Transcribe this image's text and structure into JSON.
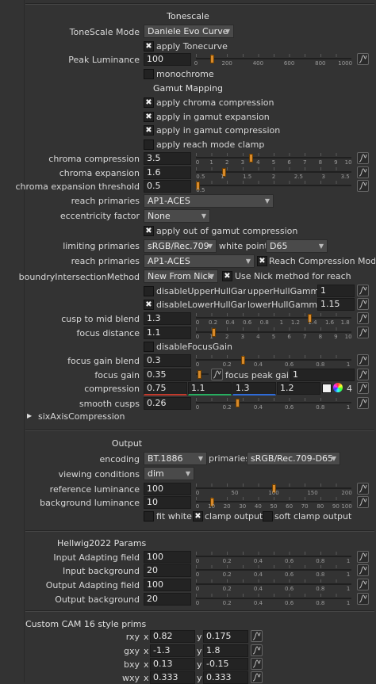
{
  "tonescale": {
    "header": "Tonescale",
    "mode_label": "ToneScale Mode",
    "mode_value": "Daniele Evo Curve",
    "apply_tonecurve": "apply Tonecurve",
    "peak_label": "Peak Luminance",
    "peak_value": "100",
    "peak_ticks": [
      "0",
      "200",
      "400",
      "600",
      "800",
      "1000"
    ],
    "monochrome": "monochrome"
  },
  "gamut": {
    "header": "Gamut Mapping",
    "apply_chroma": "apply chroma compression",
    "apply_expansion": "apply in gamut expansion",
    "apply_compression": "apply in gamut compression",
    "apply_reach": "apply reach mode clamp",
    "chroma_comp_label": "chroma compression",
    "chroma_comp_value": "3.5",
    "chroma_comp_ticks": [
      "0",
      "1",
      "2",
      "3",
      "4",
      "5",
      "6",
      "7",
      "8",
      "9",
      "10"
    ],
    "chroma_exp_label": "chroma expansion",
    "chroma_exp_value": "1.6",
    "chroma_exp_ticks": [
      "0.5",
      "1",
      "1.5",
      "2",
      "2.5",
      "3",
      "3.5"
    ],
    "chroma_thr_label": "chroma expansion threshold",
    "chroma_thr_value": "0.5",
    "chroma_thr_ticks": [
      "0.5"
    ],
    "reach_label": "reach primaries",
    "reach_value": "AP1-ACES",
    "ecc_label": "eccentricity factor",
    "ecc_value": "None",
    "apply_out": "apply out of gamut compression",
    "lim_label": "limiting primaries",
    "lim_value": "sRGB/Rec.709",
    "white_label": "white point",
    "white_value": "D65",
    "reach2_label": "reach primaries",
    "reach2_value": "AP1-ACES",
    "reach_comp": "Reach Compression Mode",
    "boundry_label": "boundryIntersectionMethod",
    "boundry_value": "New From Nick",
    "use_nick": "Use Nick method for reach",
    "dis_upper": "disableUpperHullGamma",
    "upper_label": "upperHullGamma",
    "upper_value": "1",
    "dis_lower": "disableLowerHullGamma",
    "lower_label": "lowerHullGamma",
    "lower_value": "1.15",
    "cusp_label": "cusp to mid blend",
    "cusp_value": "1.3",
    "cusp_ticks": [
      "0",
      "0.2",
      "0.4",
      "0.6",
      "0.8",
      "1",
      "1.2",
      "1.4",
      "1.6",
      "1.8"
    ],
    "focus_label": "focus distance",
    "focus_value": "1.1",
    "focus_ticks": [
      "0",
      "1",
      "2",
      "3",
      "4",
      "5",
      "6",
      "7",
      "8",
      "9",
      "10"
    ],
    "dis_focus": "disableFocusGain",
    "fgb_label": "focus gain blend",
    "fgb_value": "0.3",
    "fgb_ticks": [
      "0",
      "0.2",
      "0.4",
      "0.6",
      "0.8",
      "1"
    ],
    "fg_label": "focus gain",
    "fg_value": "0.35",
    "fpg_label": "focus peak gain",
    "fpg_value": "1",
    "comp_label": "compression",
    "comp_values": [
      "0.75",
      "1.1",
      "1.3",
      "1.2"
    ],
    "comp_count": "4",
    "smooth_label": "smooth cusps",
    "smooth_value": "0.26",
    "smooth_ticks": [
      "0",
      "0.2",
      "0.4",
      "0.6",
      "0.8",
      "1"
    ],
    "six_axis": "sixAxisCompression"
  },
  "output": {
    "header": "Output",
    "enc_label": "encoding",
    "enc_value": "BT.1886",
    "prim_label": "primaries",
    "prim_value": "sRGB/Rec.709-D65",
    "view_label": "viewing conditions",
    "view_value": "dim",
    "ref_label": "reference luminance",
    "ref_value": "100",
    "ref_ticks": [
      "0",
      "50",
      "100",
      "150",
      "200"
    ],
    "bg_label": "background luminance",
    "bg_value": "10",
    "bg_ticks": [
      "0",
      "10",
      "20",
      "30",
      "40",
      "50",
      "60",
      "70",
      "80",
      "90",
      "100"
    ],
    "fit_white": "fit white",
    "clamp": "clamp output",
    "soft_clamp": "soft clamp output"
  },
  "hellwig": {
    "header": "Hellwig2022 Params",
    "iaf_label": "Input Adapting field",
    "iaf_value": "100",
    "ib_label": "Input background",
    "ib_value": "20",
    "oaf_label": "Output Adapting field",
    "oaf_value": "100",
    "ob_label": "Output background",
    "ob_value": "20",
    "ticks": [
      "0",
      "0.2",
      "0.4",
      "0.6",
      "0.8",
      "1"
    ]
  },
  "cam": {
    "header": "Custom CAM 16 style prims",
    "rows": [
      {
        "label": "rxy",
        "x": "0.82",
        "y": "0.175"
      },
      {
        "label": "gxy",
        "x": "-1.3",
        "y": "1.8"
      },
      {
        "label": "bxy",
        "x": "0.13",
        "y": "-0.15"
      },
      {
        "label": "wxy",
        "x": "0.333",
        "y": "0.333"
      }
    ],
    "x_prefix": "x",
    "y_prefix": "y"
  },
  "colors": {
    "handle": "#d88a2a",
    "bg": "#333333",
    "field": "#232323",
    "comp_red": "#c0392b",
    "comp_green": "#27ae60",
    "comp_blue": "#2e6bd8"
  }
}
